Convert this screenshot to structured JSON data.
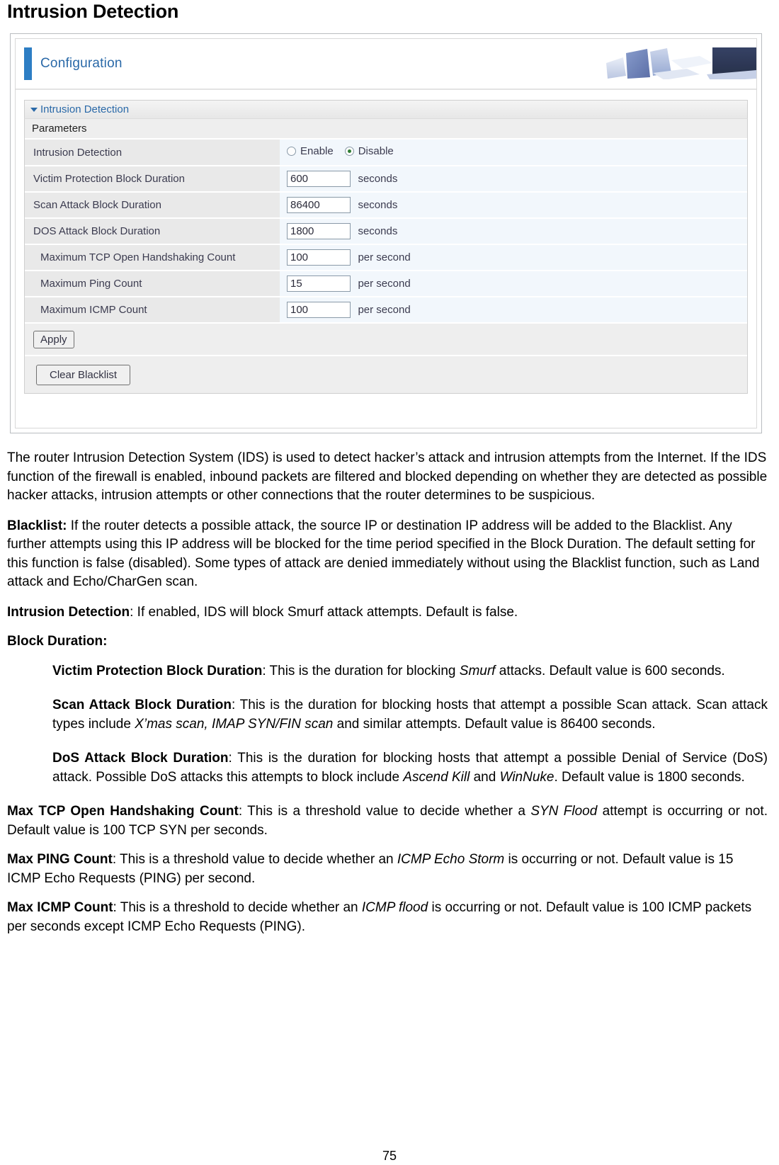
{
  "page": {
    "title": "Intrusion Detection",
    "number": "75"
  },
  "screenshot": {
    "header": {
      "config_label": "Configuration",
      "photo_alt": "laptops-photo"
    },
    "section": {
      "title": "Intrusion Detection",
      "params_title": "Parameters"
    },
    "rows": [
      {
        "label": "Intrusion Detection",
        "type": "radio",
        "options": [
          {
            "label": "Enable",
            "selected": false
          },
          {
            "label": "Disable",
            "selected": true
          }
        ]
      },
      {
        "label": "Victim Protection Block Duration",
        "type": "text",
        "value": "600",
        "unit": "seconds",
        "indent": false
      },
      {
        "label": "Scan Attack Block Duration",
        "type": "text",
        "value": "86400",
        "unit": "seconds",
        "indent": false
      },
      {
        "label": "DOS Attack Block Duration",
        "type": "text",
        "value": "1800",
        "unit": "seconds",
        "indent": false
      },
      {
        "label": "Maximum TCP Open Handshaking Count",
        "type": "text",
        "value": "100",
        "unit": "per second",
        "indent": true
      },
      {
        "label": "Maximum Ping Count",
        "type": "text",
        "value": "15",
        "unit": "per second",
        "indent": true
      },
      {
        "label": "Maximum ICMP Count",
        "type": "text",
        "value": "100",
        "unit": "per second",
        "indent": true
      }
    ],
    "buttons": {
      "apply": "Apply",
      "clear_blacklist": "Clear Blacklist"
    },
    "colors": {
      "accent_blue": "#2a69a8",
      "bar_blue": "#2d7ec4",
      "radio_dot": "#2f7d34",
      "label_cell": "#e9e9e9",
      "value_cell": "#f2f7fc"
    }
  },
  "prose": {
    "intro": "The router Intrusion Detection System (IDS) is used to detect hacker’s attack and intrusion attempts from the Internet. If the IDS function of the firewall is enabled, inbound packets are filtered and blocked depending on whether they are detected as possible hacker attacks, intrusion attempts or other connections that the router determines to be suspicious.",
    "blacklist_term": "Blacklist:",
    "blacklist_text": " If the router detects a possible attack, the source IP or destination IP address will be added to the Blacklist. Any further attempts using this IP address will be blocked for the time period specified in the Block Duration. The default setting for this function is false (disabled). Some types of attack are denied immediately without using the Blacklist function, such as Land attack and Echo/CharGen scan.",
    "intrusion_term": "Intrusion Detection",
    "intrusion_text": ": If enabled, IDS will block Smurf attack attempts. Default is false.",
    "block_duration_heading": "Block Duration:",
    "victim_term": "Victim Protection Block Duration",
    "victim_text_a": ": This is the duration for blocking ",
    "victim_em": "Smurf",
    "victim_text_b": " attacks. Default value is 600 seconds.",
    "scan_term": "Scan Attack Block Duration",
    "scan_text_a": ": This is the duration for blocking hosts that attempt a possible Scan attack. Scan attack types include ",
    "scan_em": "X’mas scan, IMAP SYN/FIN scan",
    "scan_text_b": " and similar attempts. Default value is 86400 seconds.",
    "dos_term": "DoS Attack Block Duration",
    "dos_text_a": ": This is the duration for blocking hosts that attempt a possible Denial of Service (DoS) attack. Possible DoS attacks this attempts to block include ",
    "dos_em1": "Ascend Kill",
    "dos_text_b": " and ",
    "dos_em2": "WinNuke",
    "dos_text_c": ". Default value is 1800 seconds.",
    "tcp_term": "Max TCP Open Handshaking Count",
    "tcp_text_a": ": This is a threshold value to decide whether a ",
    "tcp_em": "SYN Flood",
    "tcp_text_b": " attempt is occurring or not. Default value is 100 TCP SYN per seconds.",
    "ping_term": "Max PING Count",
    "ping_text_a": ": This is a threshold value to decide whether an ",
    "ping_em": "ICMP Echo Storm",
    "ping_text_b": " is occurring or not. Default value is 15 ICMP Echo Requests (PING) per second.",
    "icmp_term": "Max ICMP Count",
    "icmp_text_a": ": This is a threshold to decide whether an ",
    "icmp_em": "ICMP flood",
    "icmp_text_b": " is occurring or not. Default value is 100 ICMP packets per seconds except ICMP Echo Requests (PING)."
  }
}
